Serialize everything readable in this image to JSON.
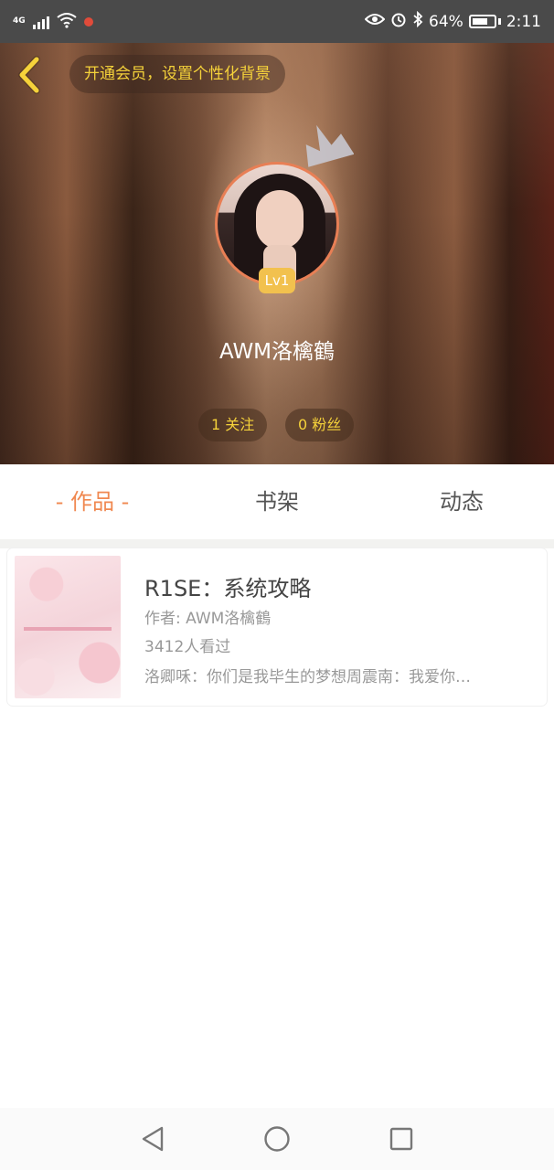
{
  "status_bar": {
    "network": "4G",
    "battery_percent": "64%",
    "time": "2:11",
    "icons": [
      "signal-icon",
      "wifi-icon",
      "notification-icon",
      "eye-icon",
      "alarm-icon",
      "bluetooth-icon",
      "battery-icon"
    ]
  },
  "header": {
    "vip_banner": "开通会员，设置个性化背景",
    "level_badge": "Lv1",
    "username": "AWM洛檎鶴",
    "follow_label": "1 关注",
    "fans_label": "0 粉丝",
    "accent_color": "#f5d23a"
  },
  "tabs": [
    {
      "label": "- 作品 -",
      "active": true
    },
    {
      "label": "书架",
      "active": false
    },
    {
      "label": "动态",
      "active": false
    }
  ],
  "works": [
    {
      "title": "R1SE：系统攻略",
      "author": "作者: AWM洛檎鶴",
      "views": "3412人看过",
      "description": "洛卿咊：你们是我毕生的梦想周震南：我爱你…"
    }
  ],
  "colors": {
    "tab_active": "#f08850",
    "avatar_border": "#e87f55",
    "badge": "#f2c14e"
  }
}
